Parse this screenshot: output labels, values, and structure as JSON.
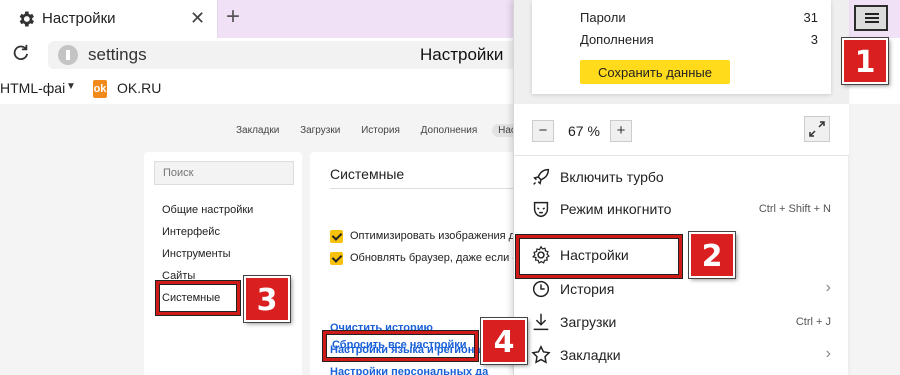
{
  "tab": {
    "title": "Настройки",
    "close": "✕",
    "new_tab": "+"
  },
  "address": {
    "url": "settings",
    "page_title": "Настройки"
  },
  "bookmarks": {
    "folder": "HTML-фаі",
    "caret": "▼",
    "ok_icon_letter": "ok",
    "ok_label": "OK.RU"
  },
  "settings_nav": [
    "Закладки",
    "Загрузки",
    "История",
    "Дополнения",
    "Настройки"
  ],
  "sidebar": {
    "search_placeholder": "Поиск",
    "items": [
      "Общие настройки",
      "Интерфейс",
      "Инструменты",
      "Сайты",
      "Системные"
    ]
  },
  "main": {
    "section_title": "Системные",
    "checkboxes": [
      "Оптимизировать изображения для",
      "Обновлять браузер, даже если он"
    ],
    "links": [
      "Очистить историю",
      "Настройки языка и региона",
      "Настройки персональных да",
      "Сбросить все настройки"
    ]
  },
  "menu": {
    "sync": [
      {
        "label": "Пароли",
        "count": "31"
      },
      {
        "label": "Дополнения",
        "count": "3"
      }
    ],
    "save_button": "Сохранить данные",
    "zoom": {
      "minus": "−",
      "value": "67 %",
      "plus": "+"
    },
    "items": [
      {
        "icon": "rocket-icon",
        "label": "Включить турбо",
        "shortcut": ""
      },
      {
        "icon": "incognito-mask-icon",
        "label": "Режим инкогнито",
        "shortcut": "Ctrl + Shift + N"
      },
      {
        "icon": "gear-icon",
        "label": "Настройки",
        "shortcut": ""
      },
      {
        "icon": "clock-icon",
        "label": "История",
        "shortcut": ""
      },
      {
        "icon": "download-icon",
        "label": "Загрузки",
        "shortcut": "Ctrl + J"
      },
      {
        "icon": "star-icon",
        "label": "Закладки",
        "shortcut": ""
      }
    ],
    "submenu_arrow": "›"
  },
  "annotations": [
    "1",
    "2",
    "3",
    "4"
  ],
  "colors": {
    "highlight": "#cf1a1a",
    "link": "#1a61d8",
    "accent_yellow": "#ffdb1c",
    "tab_strip": "#f0e1f6"
  }
}
